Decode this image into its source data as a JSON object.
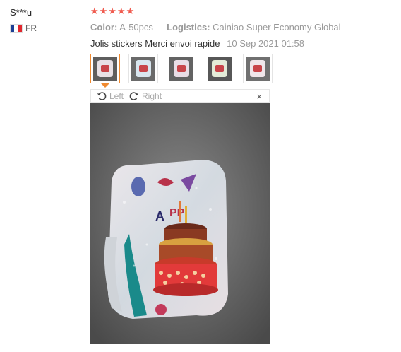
{
  "reviewer": {
    "name": "S***u",
    "country_code": "FR",
    "flag_colors": [
      "#1c3f94",
      "#ffffff",
      "#e1262d"
    ]
  },
  "rating": {
    "stars": 5,
    "max": 5,
    "display": "★★★★★",
    "color": "#f05c50"
  },
  "attributes": {
    "color_label": "Color:",
    "color_value": "A-50pcs",
    "logistics_label": "Logistics:",
    "logistics_value": "Cainiao Super Economy Global"
  },
  "review": {
    "text": "Jolis stickers Merci envoi rapide",
    "date": "10 Sep 2021 01:58"
  },
  "thumbnails": {
    "count": 5,
    "selected_index": 0,
    "accent": "#f08a30"
  },
  "viewer": {
    "rotate_left_label": "Left",
    "rotate_right_label": "Right",
    "close_glyph": "×"
  }
}
